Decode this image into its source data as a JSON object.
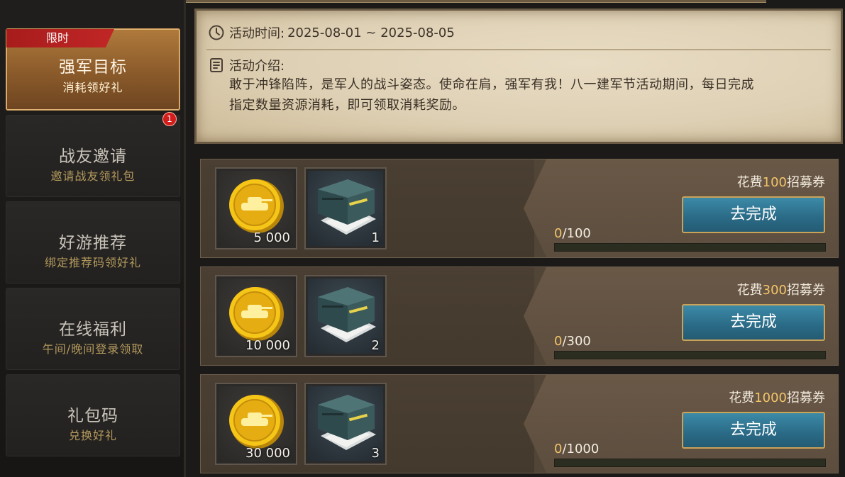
{
  "sidebar": {
    "items": [
      {
        "title": "强军目标",
        "sub": "消耗领好礼",
        "tag": "限时",
        "active": true
      },
      {
        "title": "战友邀请",
        "sub": "邀请战友领礼包",
        "badge": "1"
      },
      {
        "title": "好游推荐",
        "sub": "绑定推荐码领好礼"
      },
      {
        "title": "在线福利",
        "sub": "午间/晚间登录领取"
      },
      {
        "title": "礼包码",
        "sub": "兑换好礼"
      }
    ]
  },
  "info": {
    "time_label": "活动时间:",
    "time_value": "2025-08-01 ~ 2025-08-05",
    "intro_label": "活动介绍:",
    "intro_line1": "敢于冲锋陷阵，是军人的战斗姿态。使命在肩，强军有我！八一建军节活动期间，每日完成",
    "intro_line2": "指定数量资源消耗，即可领取消耗奖励。"
  },
  "tasks": [
    {
      "rewards": [
        {
          "icon": "gold-tank-coin-icon",
          "qty": "5 000"
        },
        {
          "icon": "supply-crate-icon",
          "qty": "1"
        }
      ],
      "cost_prefix": "花费",
      "cost_num": "100",
      "cost_suffix": "招募券",
      "button": "去完成",
      "progress_current": "0",
      "progress_total": "/100",
      "progress": 0
    },
    {
      "rewards": [
        {
          "icon": "gold-tank-coin-icon",
          "qty": "10 000"
        },
        {
          "icon": "supply-crate-icon",
          "qty": "2"
        }
      ],
      "cost_prefix": "花费",
      "cost_num": "300",
      "cost_suffix": "招募券",
      "button": "去完成",
      "progress_current": "0",
      "progress_total": "/300",
      "progress": 0
    },
    {
      "rewards": [
        {
          "icon": "gold-tank-coin-icon",
          "qty": "30 000"
        },
        {
          "icon": "supply-crate-icon",
          "qty": "3"
        }
      ],
      "cost_prefix": "花费",
      "cost_num": "1000",
      "cost_suffix": "招募券",
      "button": "去完成",
      "progress_current": "0",
      "progress_total": "/1000",
      "progress": 0
    }
  ],
  "colors": {
    "accent_gold": "#f3c56a",
    "button_blue": "#2a6a86",
    "tag_red": "#c12626"
  }
}
